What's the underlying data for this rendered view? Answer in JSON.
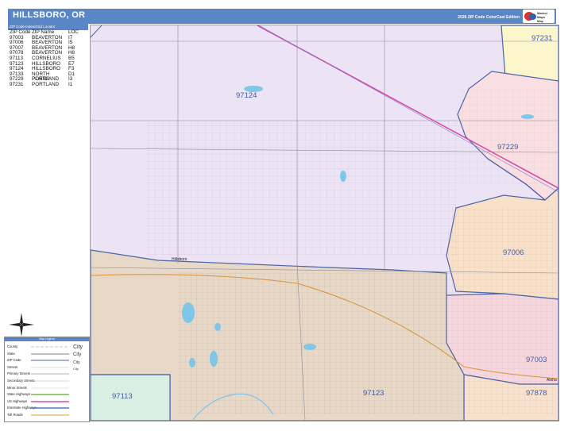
{
  "header": {
    "title": "HILLSBORO, OR",
    "edition": "2026 ZIP Code ColorCast Edition",
    "logo_text": [
      "Market",
      "Maps",
      "Map",
      "Publishers"
    ]
  },
  "index": {
    "heading": "ZIP Code Index/Grid Locator",
    "columns": [
      "ZIP Code",
      "ZIP Name",
      "LOC"
    ],
    "rows": [
      {
        "zip": "97003",
        "name": "BEAVERTON",
        "loc": "I7"
      },
      {
        "zip": "97006",
        "name": "BEAVERTON",
        "loc": "I5"
      },
      {
        "zip": "97007",
        "name": "BEAVERTON",
        "loc": "H8"
      },
      {
        "zip": "97078",
        "name": "BEAVERTON",
        "loc": "H8"
      },
      {
        "zip": "97113",
        "name": "CORNELIUS",
        "loc": "B5"
      },
      {
        "zip": "97123",
        "name": "HILLSBORO",
        "loc": "E7"
      },
      {
        "zip": "97124",
        "name": "HILLSBORO",
        "loc": "F3"
      },
      {
        "zip": "97133",
        "name": "NORTH PLAINS",
        "loc": "D1"
      },
      {
        "zip": "97229",
        "name": "PORTLAND",
        "loc": "I3"
      },
      {
        "zip": "97231",
        "name": "PORTLAND",
        "loc": "I1"
      }
    ]
  },
  "map": {
    "zip_labels": [
      "97231",
      "97124",
      "97229",
      "97006",
      "97003",
      "97113",
      "97123",
      "97878"
    ],
    "city_labels": [
      "Hillsboro",
      "Aloha"
    ],
    "colors": {
      "z97124": "#ece3f4",
      "z97231": "#fbf6cc",
      "z97229": "#f9dfe1",
      "z97006": "#f9e0c8",
      "z97003": "#f6d7de",
      "z97123": "#e8d8c7",
      "z97113": "#d9efe3",
      "z97878": "#f8e1cd",
      "boundary": "#4b64a8",
      "highway": "#d54da8",
      "water": "#7fc6e8",
      "streets": "#b5aac0"
    }
  },
  "legend": {
    "heading": "Map Legend",
    "items": [
      "County",
      "State",
      "ZIP Code",
      "Streets",
      "Primary Streets",
      "Secondary Streets",
      "Minor Streets",
      "State Highways",
      "US Highways",
      "Interstate Highways",
      "Toll Roads"
    ],
    "city_samples": [
      "City",
      "City",
      "City",
      "City"
    ]
  }
}
